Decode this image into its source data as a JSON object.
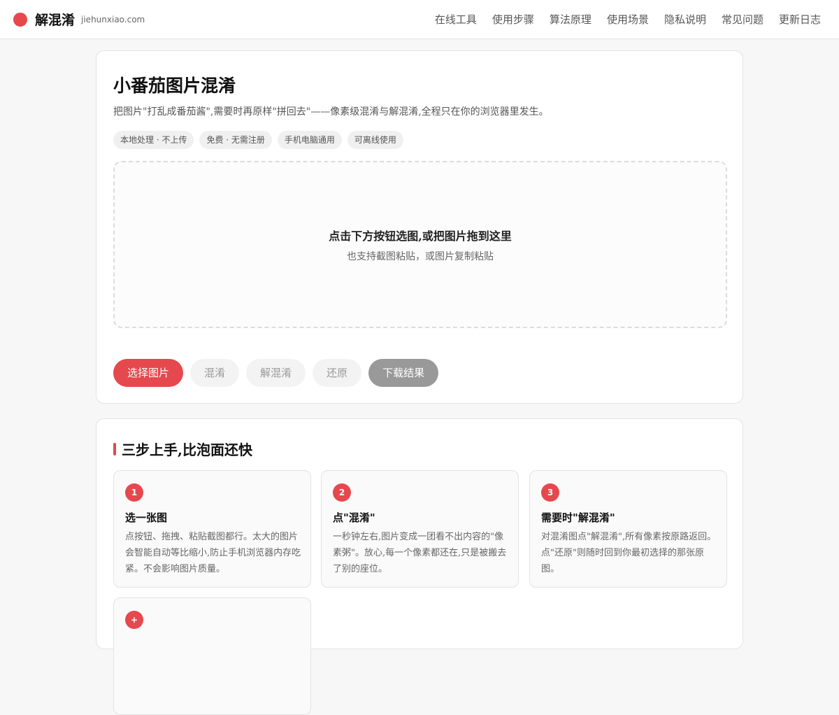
{
  "header": {
    "brand_name": "解混淆",
    "domain": "jiehunxiao.com",
    "nav": [
      "在线工具",
      "使用步骤",
      "算法原理",
      "使用场景",
      "隐私说明",
      "常见问题",
      "更新日志"
    ]
  },
  "main": {
    "title": "小番茄图片混淆",
    "subtitle": "把图片\"打乱成番茄酱\",需要时再原样\"拼回去\"——像素级混淆与解混淆,全程只在你的浏览器里发生。",
    "tags": [
      "本地处理 · 不上传",
      "免费 · 无需注册",
      "手机电脑通用",
      "可离线使用"
    ],
    "dropzone": {
      "title": "点击下方按钮选图,或把图片拖到这里",
      "subtitle": "也支持截图粘贴，或图片复制粘贴"
    },
    "buttons": {
      "select": "选择图片",
      "obfuscate": "混淆",
      "deobfuscate": "解混淆",
      "restore": "还原",
      "download": "下载结果"
    }
  },
  "steps": {
    "title": "三步上手,比泡面还快",
    "items": [
      {
        "num": "1",
        "title": "选一张图",
        "text": "点按钮、拖拽、粘贴截图都行。太大的图片会智能自动等比缩小,防止手机浏览器内存吃紧。不会影响图片质量。"
      },
      {
        "num": "2",
        "title": "点\"混淆\"",
        "text": "一秒钟左右,图片变成一团看不出内容的\"像素粥\"。放心,每一个像素都还在,只是被搬去了别的座位。"
      },
      {
        "num": "3",
        "title": "需要时\"解混淆\"",
        "text": "对混淆图点\"解混淆\",所有像素按原路返回。点\"还原\"则随时回到你最初选择的那张原图。"
      },
      {
        "num": "+",
        "title": "",
        "text": ""
      }
    ]
  },
  "colors": {
    "accent": "#e5484d",
    "background": "#f7f7f7",
    "download_button": "#999999"
  },
  "icons": {
    "logo": "red-circle-logo"
  }
}
